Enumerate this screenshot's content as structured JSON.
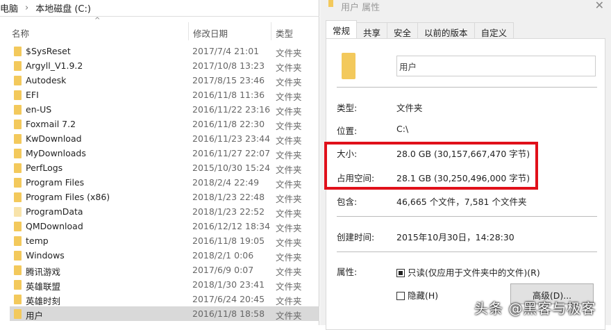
{
  "explorer": {
    "breadcrumb": [
      "电脑",
      "›",
      "本地磁盘 (C:)"
    ],
    "columns": {
      "name": "名称",
      "date": "修改日期",
      "type": "类型"
    },
    "rows": [
      {
        "name": "$SysReset",
        "date": "2017/7/4 21:01",
        "type": "文件夹"
      },
      {
        "name": "Argyll_V1.9.2",
        "date": "2017/10/8 13:23",
        "type": "文件夹"
      },
      {
        "name": "Autodesk",
        "date": "2017/8/15 23:46",
        "type": "文件夹"
      },
      {
        "name": "EFI",
        "date": "2016/11/8 11:36",
        "type": "文件夹"
      },
      {
        "name": "en-US",
        "date": "2016/11/22 23:16",
        "type": "文件夹"
      },
      {
        "name": "Foxmail 7.2",
        "date": "2016/11/8 22:30",
        "type": "文件夹"
      },
      {
        "name": "KwDownload",
        "date": "2016/11/23 23:44",
        "type": "文件夹"
      },
      {
        "name": "MyDownloads",
        "date": "2016/11/27 22:07",
        "type": "文件夹"
      },
      {
        "name": "PerfLogs",
        "date": "2015/10/30 15:24",
        "type": "文件夹"
      },
      {
        "name": "Program Files",
        "date": "2018/2/4 22:49",
        "type": "文件夹"
      },
      {
        "name": "Program Files (x86)",
        "date": "2018/1/23 22:48",
        "type": "文件夹"
      },
      {
        "name": "ProgramData",
        "date": "2018/1/23 22:52",
        "type": "文件夹"
      },
      {
        "name": "QMDownload",
        "date": "2016/12/12 18:34",
        "type": "文件夹"
      },
      {
        "name": "temp",
        "date": "2016/11/8 19:05",
        "type": "文件夹"
      },
      {
        "name": "Windows",
        "date": "2018/2/1 0:06",
        "type": "文件夹"
      },
      {
        "name": "腾讯游戏",
        "date": "2017/6/9 0:07",
        "type": "文件夹"
      },
      {
        "name": "英雄联盟",
        "date": "2018/1/30 23:41",
        "type": "文件夹"
      },
      {
        "name": "英雄时刻",
        "date": "2017/6/24 20:45",
        "type": "文件夹"
      },
      {
        "name": "用户",
        "date": "2016/11/8 18:58",
        "type": "文件夹"
      }
    ]
  },
  "dialog": {
    "title": "用户 属性",
    "close": "✕",
    "tabs": [
      "常规",
      "共享",
      "安全",
      "以前的版本",
      "自定义"
    ],
    "name_value": "用户",
    "props": {
      "type_label": "类型:",
      "type_value": "文件夹",
      "location_label": "位置:",
      "location_value": "C:\\",
      "size_label": "大小:",
      "size_value": "28.0 GB (30,157,667,470 字节)",
      "disk_label": "占用空间:",
      "disk_value": "28.1 GB (30,250,496,000 字节)",
      "contains_label": "包含:",
      "contains_value": "46,665 个文件，7,581 个文件夹",
      "created_label": "创建时间:",
      "created_value": "2015年10月30日，14:28:30",
      "attr_label": "属性:",
      "readonly": "只读(仅应用于文件夹中的文件)(R)",
      "hidden": "隐藏(H)",
      "advanced": "高级(D)..."
    }
  },
  "watermark": "头条 @黑客与极客"
}
